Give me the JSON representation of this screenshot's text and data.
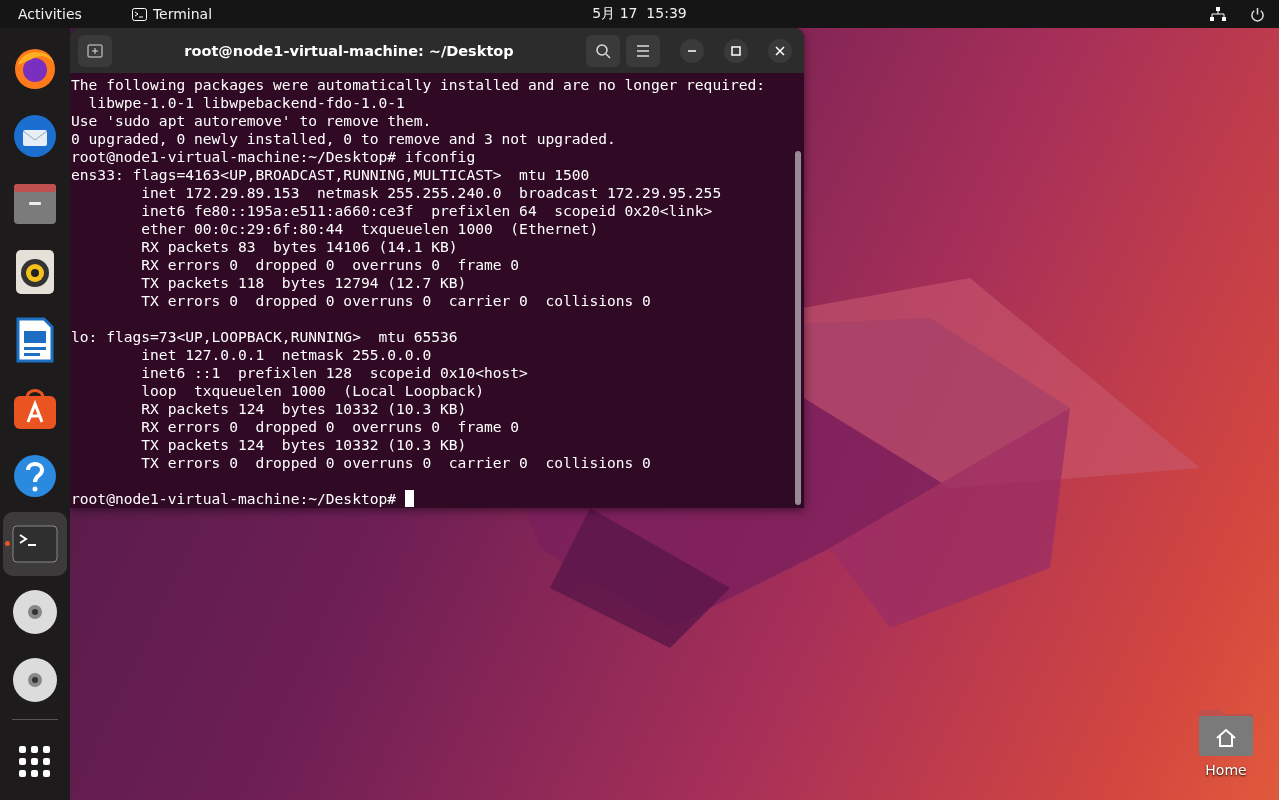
{
  "top_bar": {
    "activities": "Activities",
    "app_name": "Terminal",
    "clock": "5月 17  15:39"
  },
  "dock": {
    "items": [
      {
        "kind": "firefox",
        "selected": false,
        "running": false
      },
      {
        "kind": "thunderbird",
        "selected": false,
        "running": false
      },
      {
        "kind": "files",
        "selected": false,
        "running": false
      },
      {
        "kind": "rhythmbox",
        "selected": false,
        "running": false
      },
      {
        "kind": "writer",
        "selected": false,
        "running": false
      },
      {
        "kind": "appcenter",
        "selected": false,
        "running": false
      },
      {
        "kind": "help",
        "selected": false,
        "running": false
      },
      {
        "kind": "terminal",
        "selected": true,
        "running": true
      },
      {
        "kind": "disc",
        "selected": false,
        "running": false
      },
      {
        "kind": "disc",
        "selected": false,
        "running": false
      }
    ]
  },
  "terminal": {
    "title": "root@node1-virtual-machine: ~/Desktop",
    "output_blocks": [
      {
        "lines": [
          "The following packages were automatically installed and are no longer required:",
          "  libwpe-1.0-1 libwpebackend-fdo-1.0-1",
          "Use 'sudo apt autoremove' to remove them.",
          "0 upgraded, 0 newly installed, 0 to remove and 3 not upgraded.",
          "root@node1-virtual-machine:~/Desktop# ifconfig",
          "ens33: flags=4163<UP,BROADCAST,RUNNING,MULTICAST>  mtu 1500",
          "        inet 172.29.89.153  netmask 255.255.240.0  broadcast 172.29.95.255",
          "        inet6 fe80::195a:e511:a660:ce3f  prefixlen 64  scopeid 0x20<link>",
          "        ether 00:0c:29:6f:80:44  txqueuelen 1000  (Ethernet)",
          "        RX packets 83  bytes 14106 (14.1 KB)",
          "        RX errors 0  dropped 0  overruns 0  frame 0",
          "        TX packets 118  bytes 12794 (12.7 KB)",
          "        TX errors 0  dropped 0 overruns 0  carrier 0  collisions 0"
        ]
      },
      {
        "lines": [
          "lo: flags=73<UP,LOOPBACK,RUNNING>  mtu 65536",
          "        inet 127.0.0.1  netmask 255.0.0.0",
          "        inet6 ::1  prefixlen 128  scopeid 0x10<host>",
          "        loop  txqueuelen 1000  (Local Loopback)",
          "        RX packets 124  bytes 10332 (10.3 KB)",
          "        RX errors 0  dropped 0  overruns 0  frame 0",
          "        TX packets 124  bytes 10332 (10.3 KB)",
          "        TX errors 0  dropped 0 overruns 0  carrier 0  collisions 0"
        ]
      }
    ],
    "prompt": {
      "text": "root@node1-virtual-machine:~/Desktop# ",
      "cursor": true
    }
  },
  "desktop_icons": [
    {
      "label": "Home"
    }
  ]
}
